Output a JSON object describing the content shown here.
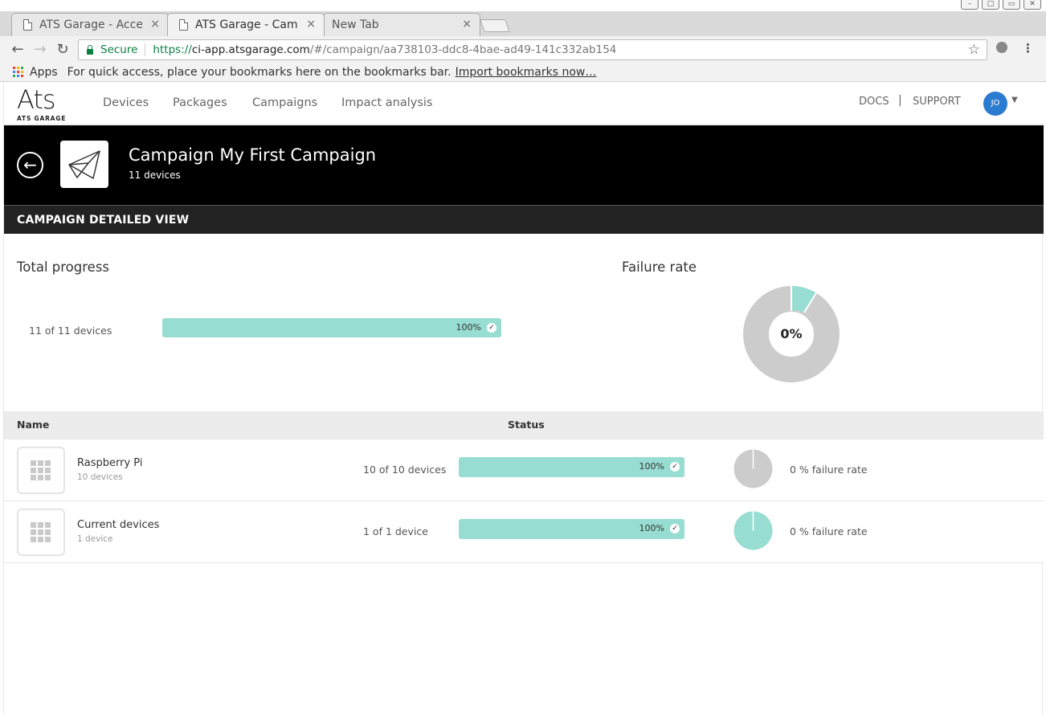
{
  "browser": {
    "tabs": [
      {
        "title": "ATS Garage - Access",
        "close": "×"
      },
      {
        "title": "ATS Garage - Campaign",
        "close": "×"
      },
      {
        "title": "New Tab",
        "close": "×"
      }
    ],
    "secure_label": "Secure",
    "url_scheme": "https://",
    "url_host": "ci-app.atsgarage.com",
    "url_path": "/#/campaign/aa738103-ddc8-4bae-ad49-141c332ab154",
    "bookmarks": {
      "apps_label": "Apps",
      "hint": "For quick access, place your bookmarks here on the bookmarks bar.",
      "import_link": "Import bookmarks now…"
    }
  },
  "app": {
    "logo": {
      "main": "Ats",
      "sub": "ATS GARAGE"
    },
    "nav": [
      "Devices",
      "Packages",
      "Campaigns",
      "Impact analysis"
    ],
    "docs": "DOCS",
    "divider": "|",
    "support": "SUPPORT",
    "avatar": "JO",
    "accent_color": "#98ddd2",
    "avatar_color": "#2b7bd0"
  },
  "campaign": {
    "title": "Campaign My First Campaign",
    "subtitle": "11 devices",
    "detail_header": "CAMPAIGN DETAILED VIEW"
  },
  "overview": {
    "total_title": "Total progress",
    "total_count": "11 of 11 devices",
    "progress_label": "100%",
    "progress_fraction": 1.0,
    "failure_title": "Failure rate",
    "failure_label": "0%",
    "failure_fraction": 0.0
  },
  "table": {
    "headers": {
      "name": "Name",
      "status": "Status"
    },
    "rows": [
      {
        "name": "Raspberry Pi",
        "sub": "10 devices",
        "count": "10 of 10 devices",
        "progress_label": "100%",
        "progress_fraction": 1.0,
        "rate": "0 % failure rate",
        "pie_state": "pending"
      },
      {
        "name": "Current devices",
        "sub": "1 device",
        "count": "1 of 1 device",
        "progress_label": "100%",
        "progress_fraction": 1.0,
        "rate": "0 % failure rate",
        "pie_state": "success"
      }
    ]
  }
}
